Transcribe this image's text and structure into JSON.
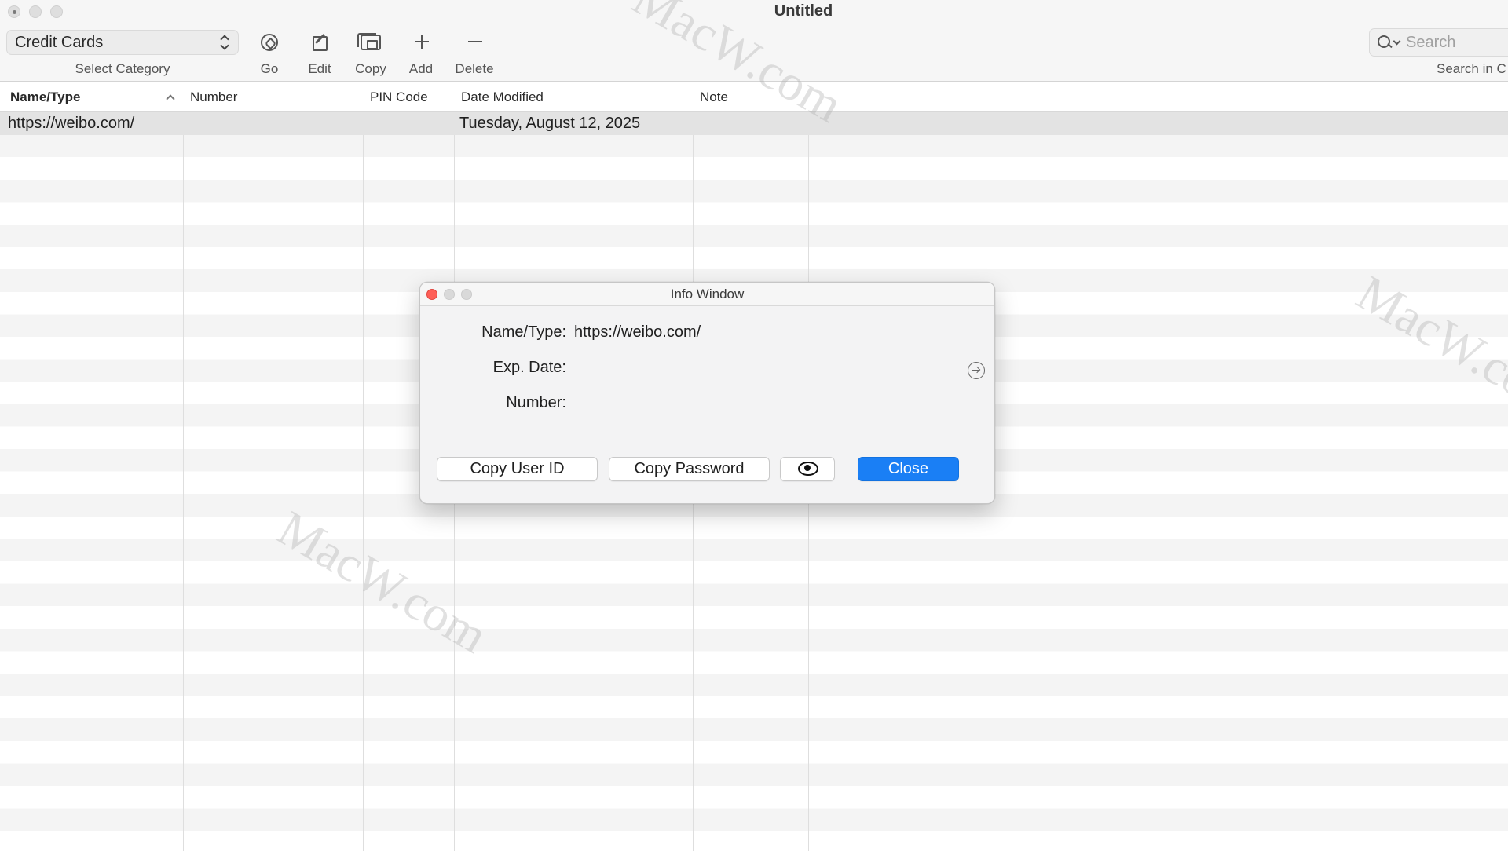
{
  "window": {
    "title": "Untitled"
  },
  "toolbar": {
    "category_value": "Credit Cards",
    "category_caption": "Select Category",
    "go_label": "Go",
    "edit_label": "Edit",
    "copy_label": "Copy",
    "add_label": "Add",
    "delete_label": "Delete",
    "search_placeholder": "Search",
    "search_caption": "Search in C"
  },
  "table": {
    "columns": [
      "Name/Type",
      "Number",
      "PIN Code",
      "Date Modified",
      "Note"
    ],
    "sorted_column": "Name/Type",
    "rows": [
      {
        "name": "https://weibo.com/",
        "number": "",
        "pin": "",
        "date": "Tuesday, August 12, 2025",
        "note": ""
      }
    ]
  },
  "info_window": {
    "title": "Info Window",
    "name_label": "Name/Type:",
    "name_value": "https://weibo.com/",
    "exp_label": "Exp. Date:",
    "exp_value": "",
    "number_label": "Number:",
    "number_value": "",
    "copy_user_id_label": "Copy User ID",
    "copy_password_label": "Copy Password",
    "close_label": "Close"
  },
  "watermark": {
    "text": "MacW.com"
  },
  "colors": {
    "accent": "#1a7ff5",
    "close_dot": "#fe5f57",
    "selected_row": "#e3e3e3"
  }
}
